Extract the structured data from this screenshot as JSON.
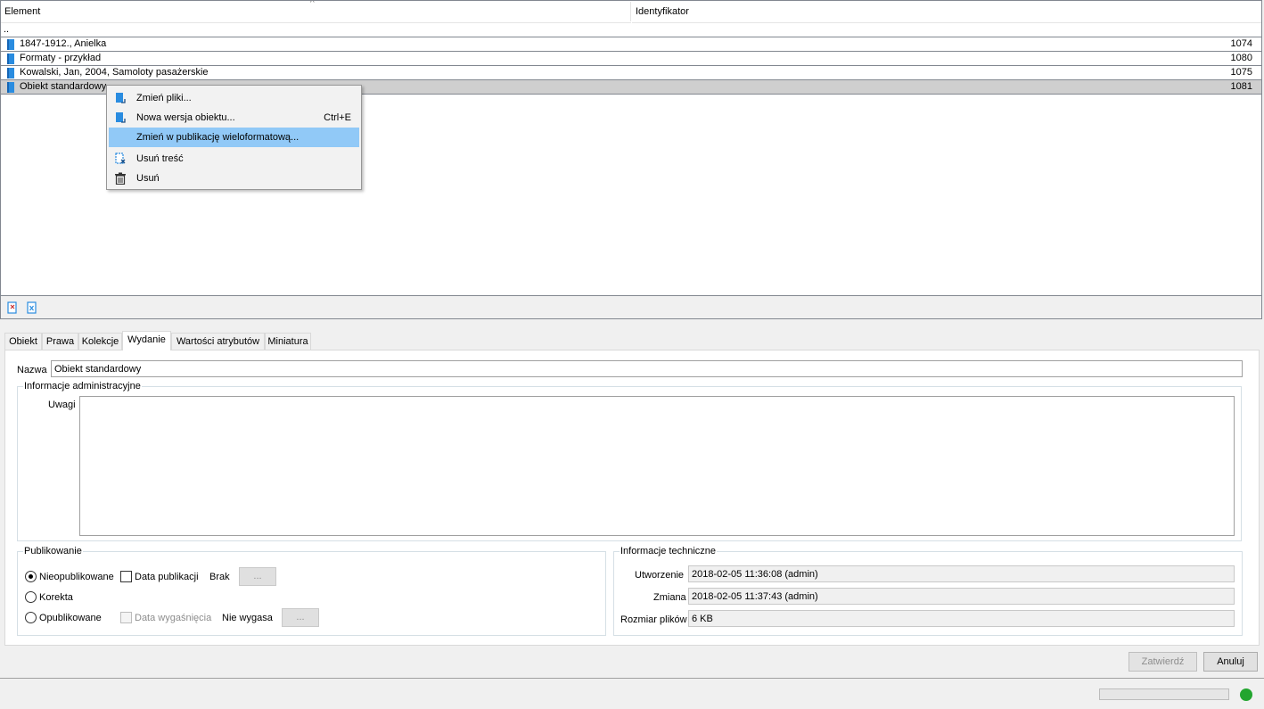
{
  "list": {
    "columns": [
      "Element",
      "Identyfikator"
    ],
    "parent_row": "..",
    "rows": [
      {
        "name": "1847-1912., Anielka",
        "id": "1074"
      },
      {
        "name": "Formaty - przykład",
        "id": "1080"
      },
      {
        "name": "Kowalski, Jan, 2004, Samoloty pasażerskie",
        "id": "1075"
      },
      {
        "name": "Obiekt standardowy",
        "id": "1081"
      }
    ]
  },
  "context_menu": {
    "items": [
      {
        "label": "Zmień pliki...",
        "shortcut": ""
      },
      {
        "label": "Nowa wersja obiektu...",
        "shortcut": "Ctrl+E"
      },
      {
        "label": "Zmień w publikację wieloformatową...",
        "shortcut": ""
      },
      {
        "label": "Usuń treść",
        "shortcut": ""
      },
      {
        "label": "Usuń",
        "shortcut": ""
      }
    ]
  },
  "tabs": [
    "Obiekt",
    "Prawa",
    "Kolekcje",
    "Wydanie",
    "Wartości atrybutów",
    "Miniatura"
  ],
  "active_tab": "Wydanie",
  "form": {
    "name_label": "Nazwa",
    "name_value": "Obiekt standardowy",
    "admin_group": "Informacje administracyjne",
    "notes_label": "Uwagi",
    "notes_value": "",
    "publish_group": "Publikowanie",
    "radio_unpublished": "Nieopublikowane",
    "radio_proof": "Korekta",
    "radio_published": "Opublikowane",
    "publish_date_label": "Data publikacji",
    "publish_date_value": "Brak",
    "expiry_date_label": "Data wygaśnięcia",
    "expiry_date_value": "Nie wygasa",
    "dots": "...",
    "tech_group": "Informacje techniczne",
    "created_label": "Utworzenie",
    "created_value": "2018-02-05 11:36:08 (admin)",
    "modified_label": "Zmiana",
    "modified_value": "2018-02-05 11:37:43 (admin)",
    "size_label": "Rozmiar plików",
    "size_value": "6 KB"
  },
  "buttons": {
    "confirm": "Zatwierdź",
    "cancel": "Anuluj"
  },
  "colors": {
    "menu_highlight": "#91c9f7",
    "selected_row": "#cfcfcf",
    "status_ok": "#22a52f",
    "doc_icon": "#2a8ce0"
  }
}
